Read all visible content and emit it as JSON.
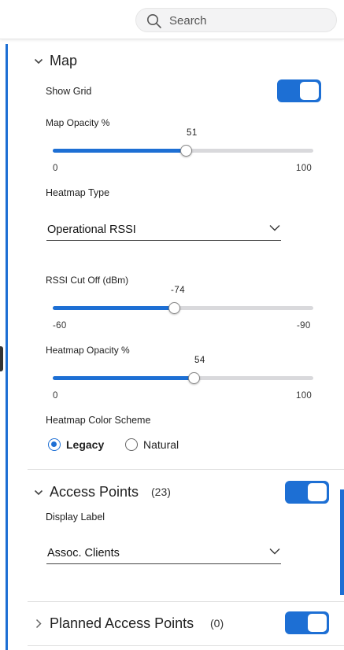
{
  "search": {
    "placeholder": "Search"
  },
  "map": {
    "title": "Map",
    "show_grid_label": "Show Grid",
    "show_grid_on": true,
    "opacity": {
      "label": "Map Opacity %",
      "value": "51",
      "min": "0",
      "max": "100",
      "fraction": 0.51
    },
    "heatmap_type": {
      "label": "Heatmap Type",
      "selected": "Operational RSSI"
    },
    "rssi": {
      "label": "RSSI Cut Off (dBm)",
      "value": "-74",
      "min": "-60",
      "max": "-90",
      "fraction": 0.4667
    },
    "heatmap_opacity": {
      "label": "Heatmap Opacity %",
      "value": "54",
      "min": "0",
      "max": "100",
      "fraction": 0.54
    },
    "color_scheme": {
      "label": "Heatmap Color Scheme",
      "options": [
        "Legacy",
        "Natural"
      ],
      "selected": "Legacy"
    }
  },
  "access_points": {
    "title": "Access Points",
    "count": "(23)",
    "enabled": true,
    "display_label": {
      "label": "Display Label",
      "selected": "Assoc. Clients"
    }
  },
  "planned_access_points": {
    "title": "Planned Access Points",
    "count": "(0)",
    "enabled": true
  },
  "colors": {
    "accent": "#1d6fd4",
    "track": "#d9d9dc"
  }
}
